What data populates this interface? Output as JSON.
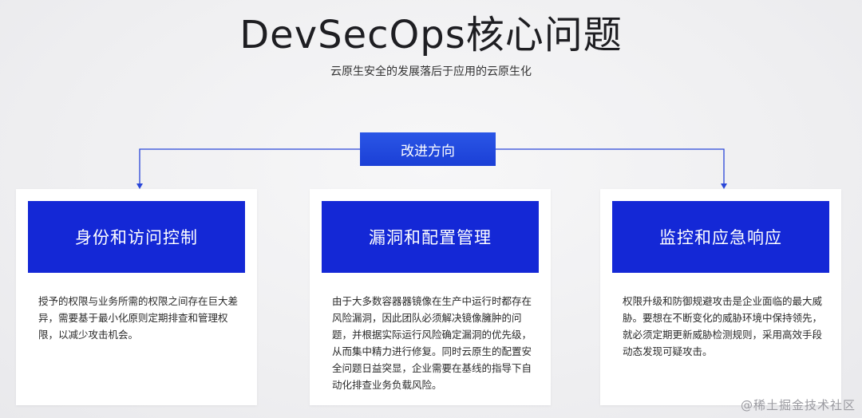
{
  "title": "DevSecOps核心问题",
  "subtitle": "云原生安全的发展落后于应用的云原生化",
  "center": "改进方向",
  "cards": [
    {
      "title": "身份和访问控制",
      "body": "授予的权限与业务所需的权限之间存在巨大差异，需要基于最小化原则定期排查和管理权限，以减少攻击机会。"
    },
    {
      "title": "漏洞和配置管理",
      "body": "由于大多数容器器镜像在生产中运行时都存在风险漏洞，因此团队必须解决镜像臃肿的问题，并根据实际运行风险确定漏洞的优先级，从而集中精力进行修复。同时云原生的配置安全问题日益突显，企业需要在基线的指导下自动化排查业务负载风险。"
    },
    {
      "title": "监控和应急响应",
      "body": "权限升级和防御规避攻击是企业面临的最大威胁。要想在不断变化的威胁环境中保持领先，就必须定期更新威胁检测规则，采用高效手段动态发现可疑攻击。"
    }
  ],
  "watermark": "@稀土掘金技术社区",
  "colors": {
    "accent": "#1428d6",
    "center_box": "#2347e0",
    "connector": "#2a46d8"
  }
}
